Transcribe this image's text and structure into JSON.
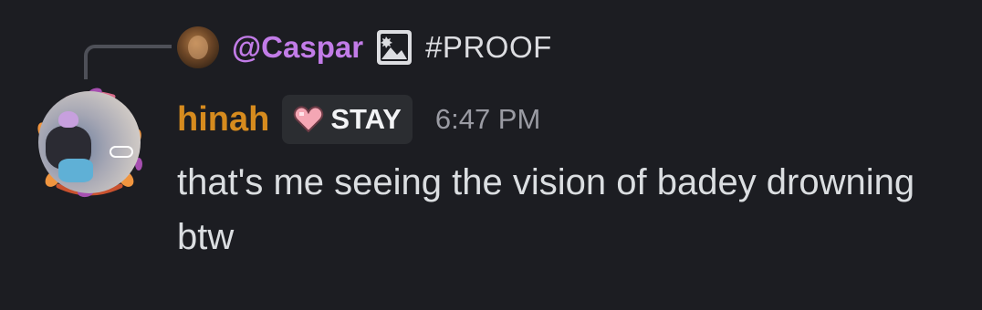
{
  "reply": {
    "author": "@Caspar",
    "content": "#PROOF",
    "attachment_icon": "image-icon"
  },
  "message": {
    "author": "hinah",
    "author_color": "#d68b1e",
    "role_tag": {
      "icon": "pink-heart-icon",
      "label": "STAY"
    },
    "timestamp": "6:47 PM",
    "content": "that's me seeing the vision of badey drowning btw"
  },
  "colors": {
    "background": "#1c1d22",
    "reply_author": "#c27ce8",
    "heart": "#f4a6b4"
  }
}
